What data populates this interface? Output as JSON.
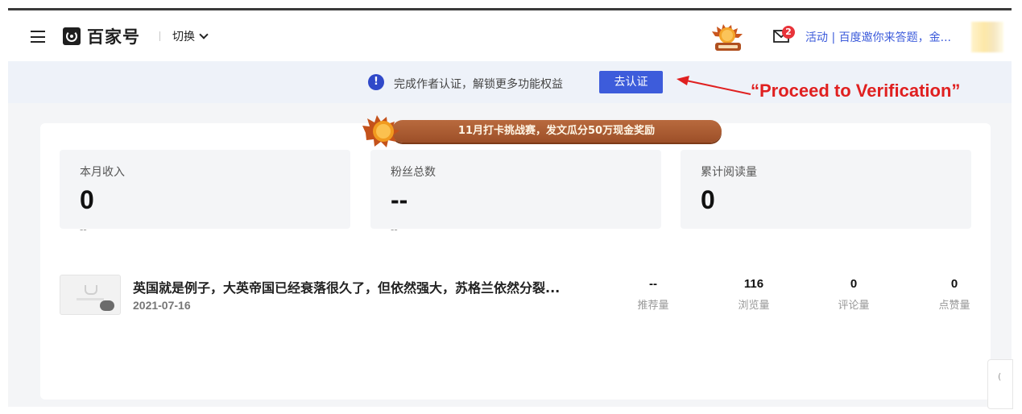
{
  "header": {
    "logo_text": "百家号",
    "switch_label": "切换",
    "mail_count": "2",
    "activity_text": "活动 | 百度邀你来答题，金..."
  },
  "notice": {
    "icon_glyph": "!",
    "text": "完成作者认证，解锁更多功能权益",
    "button_label": "去认证"
  },
  "annotation": {
    "text": "“Proceed to Verification”",
    "color": "#e02020"
  },
  "banner": {
    "text": "11月打卡挑战赛，发文瓜分50万现金奖励"
  },
  "stats": [
    {
      "label": "本月收入",
      "value": "0",
      "sub": "--"
    },
    {
      "label": "粉丝总数",
      "value": "--",
      "sub": "--"
    },
    {
      "label": "累计阅读量",
      "value": "0",
      "sub": ""
    }
  ],
  "article": {
    "title": "英国就是例子，大英帝国已经衰落很久了，但依然强大，苏格兰依然分裂...",
    "date": "2021-07-16",
    "metrics": [
      {
        "value": "--",
        "label": "推荐量"
      },
      {
        "value": "116",
        "label": "浏览量"
      },
      {
        "value": "0",
        "label": "评论量"
      },
      {
        "value": "0",
        "label": "点赞量"
      }
    ]
  },
  "colors": {
    "accent": "#3d5cdb",
    "notice_bg": "#eef2f9",
    "badge_red": "#e8333a",
    "banner_brown": "#9c4f28"
  }
}
